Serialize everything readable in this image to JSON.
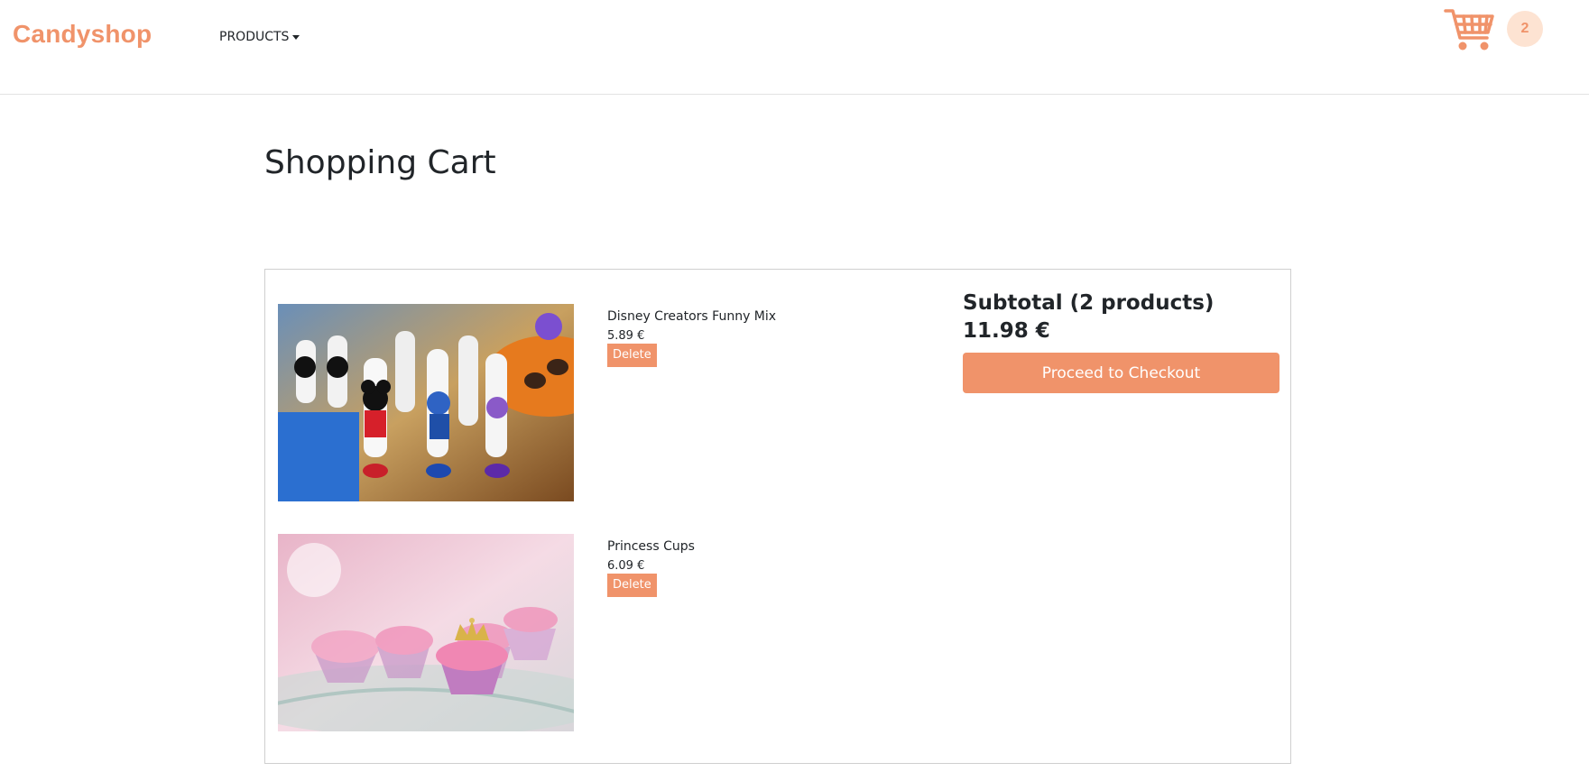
{
  "header": {
    "brand": "Candyshop",
    "nav_products": "PRODUCTS",
    "cart_count": "2"
  },
  "page": {
    "title": "Shopping Cart"
  },
  "cart": {
    "items": [
      {
        "name": "Disney Creators Funny Mix",
        "price": "5.89 €",
        "delete_label": "Delete"
      },
      {
        "name": "Princess Cups",
        "price": "6.09 €",
        "delete_label": "Delete"
      }
    ],
    "subtotal_label": "Subtotal (2 products)",
    "subtotal_value": "11.98 €",
    "checkout_label": "Proceed to Checkout"
  },
  "colors": {
    "accent": "#f0936a",
    "badge_bg": "#fde3d2",
    "text": "#212529",
    "border": "#cfcfcf"
  }
}
